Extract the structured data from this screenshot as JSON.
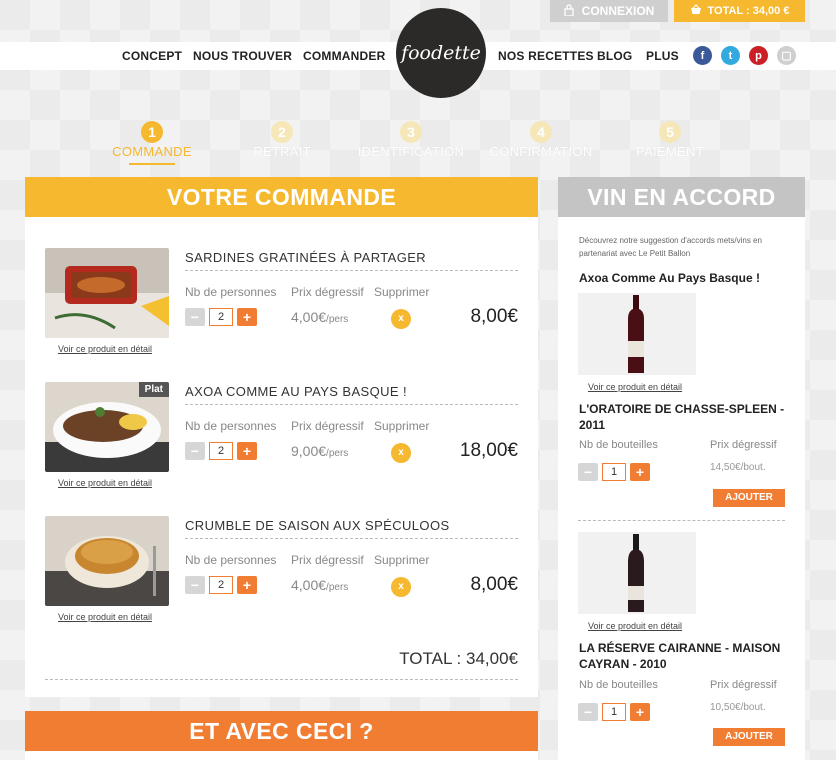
{
  "header": {
    "login_label": "CONNEXION",
    "cart_label": "TOTAL : 34,00 €",
    "logo_text": "foodette",
    "nav_left": [
      "CONCEPT",
      "NOUS TROUVER",
      "COMMANDER"
    ],
    "nav_right": [
      "NOS RECETTES",
      "BLOG",
      "PLUS"
    ],
    "social": [
      {
        "name": "facebook-icon",
        "glyph": "f",
        "color": "#3b5998"
      },
      {
        "name": "twitter-icon",
        "glyph": "t",
        "color": "#33aadd"
      },
      {
        "name": "pinterest-icon",
        "glyph": "p",
        "color": "#cb2027"
      },
      {
        "name": "instagram-icon",
        "glyph": "▢",
        "color": "#cfcfcf"
      }
    ]
  },
  "steps": [
    {
      "num": "1",
      "label": "COMMANDE",
      "active": true
    },
    {
      "num": "2",
      "label": "RETRAIT",
      "active": false
    },
    {
      "num": "3",
      "label": "IDENTIFICATION",
      "active": false
    },
    {
      "num": "4",
      "label": "CONFIRMATION",
      "active": false
    },
    {
      "num": "5",
      "label": "PAIEMENT",
      "active": false
    }
  ],
  "order": {
    "title": "VOTRE COMMANDE",
    "col_persons": "Nb de personnes",
    "col_price": "Prix dégressif",
    "col_delete": "Supprimer",
    "detail_link": "Voir ce produit en détail",
    "items": [
      {
        "name": "SARDINES GRATINÉES À PARTAGER",
        "qty": "2",
        "unit_price": "4,00€",
        "unit": "/pers",
        "total": "8,00€",
        "tag": ""
      },
      {
        "name": "AXOA COMME AU PAYS BASQUE !",
        "qty": "2",
        "unit_price": "9,00€",
        "unit": "/pers",
        "total": "18,00€",
        "tag": "Plat"
      },
      {
        "name": "CRUMBLE DE SAISON AUX SPÉCULOOS",
        "qty": "2",
        "unit_price": "4,00€",
        "unit": "/pers",
        "total": "8,00€",
        "tag": ""
      }
    ],
    "total": "TOTAL : 34,00€",
    "delete_glyph": "x",
    "minus_glyph": "−",
    "plus_glyph": "+"
  },
  "extra": {
    "title": "ET AVEC CECI ?"
  },
  "wine": {
    "title": "VIN EN ACCORD",
    "intro": "Découvrez notre suggestion d'accords mets/vins en partenariat avec Le Petit Ballon",
    "dish": "Axoa Comme Au Pays Basque !",
    "detail_link": "Voir ce produit en détail",
    "col_bottles": "Nb de bouteilles",
    "col_price": "Prix dégressif",
    "add_label": "AJOUTER",
    "items": [
      {
        "name": "L'ORATOIRE DE CHASSE-SPLEEN - 2011",
        "qty": "1",
        "price": "14,50€/bout."
      },
      {
        "name": "LA RÉSERVE CAIRANNE - MAISON CAYRAN - 2010",
        "qty": "1",
        "price": "10,50€/bout."
      }
    ]
  }
}
